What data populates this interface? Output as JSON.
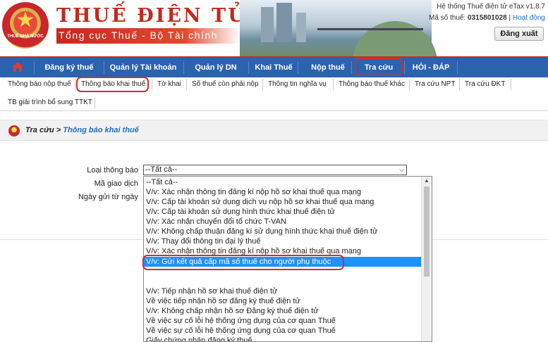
{
  "header": {
    "emblem_text": "THUẾ NHÀ NƯỚC",
    "brand_title": "THUẾ ĐIỆN TỬ",
    "brand_subtitle": "Tổng cục Thuế - Bộ Tài chính",
    "system_name": "Hệ thống Thuế điện tử eTax v1.8.7",
    "tax_code_label": "Mã số thuế:",
    "tax_code_value": "0315801028",
    "activity_link": "Hoạt động",
    "separator": "|",
    "logout_label": "Đăng xuất"
  },
  "main_nav": [
    {
      "label": "Đăng ký thuế"
    },
    {
      "label": "Quản lý Tài khoản"
    },
    {
      "label": "Quản lý DN"
    },
    {
      "label": "Khai Thuế"
    },
    {
      "label": "Nộp thuế"
    },
    {
      "label": "Tra cứu"
    },
    {
      "label": "HỎI - ĐÁP"
    }
  ],
  "sub_nav": [
    {
      "label": "Thông báo nộp thuế"
    },
    {
      "label": "Thông báo khai thuế"
    },
    {
      "label": "Tờ khai"
    },
    {
      "label": "Số thuế còn phải nộp"
    },
    {
      "label": "Thông tin nghĩa vụ"
    },
    {
      "label": "Thông báo thuế khác"
    },
    {
      "label": "Tra cứu NPT"
    },
    {
      "label": "Tra cứu ĐKT"
    },
    {
      "label": "TB giải trình bổ sung TTKT"
    }
  ],
  "breadcrumb": {
    "parent": "Tra cứu >",
    "current": "Thông báo khai thuế"
  },
  "form": {
    "notice_type_label": "Loại thông báo",
    "transaction_code_label": "Mã giao dịch",
    "send_date_label": "Ngày gửi từ ngày",
    "notice_type_value": "--Tất cả--"
  },
  "dropdown_options": [
    "--Tất cả--",
    "V/v: Xác nhận thông tin đăng kí nộp hồ sơ khai thuế qua mạng",
    "V/v: Cấp tài khoản sử dụng dịch vụ nộp hồ sơ khai thuế qua mạng",
    "V/v: Cấp tài khoản sử dụng hình thức khai thuế điện tử",
    "V/v: Xác nhận chuyển đổi tổ chức T-VAN",
    "V/v: Không chấp thuận đăng kí sử dụng hình thức khai thuế điện tử",
    "V/v: Thay đổi thông tin đại lý thuế",
    "V/v: Xác nhận thông tin đăng kí nộp hồ sơ khai thuế qua mạng",
    "V/v: Gửi kết quả cấp mã số thuế cho người phụ thuộc",
    "",
    "",
    "V/v: Tiếp nhận hồ sơ khai thuế điện tử",
    "Về việc tiếp nhận hồ sơ đăng ký thuế điện tử",
    "V/v: Không chấp nhận hồ sơ Đăng ký thuế điện tử",
    "Về việc sự cố lỗi hệ thống ứng dụng của cơ quan Thuế",
    "Về việc sự cố lỗi hệ thống ứng dụng của cơ quan Thuế",
    "Giấy chứng nhận đăng ký thuế"
  ],
  "selected_option_index": 8,
  "colors": {
    "nav_blue": "#2a63ae",
    "brand_red": "#c12a1c",
    "highlight_red": "#d62c2c",
    "selected_blue": "#1e90ff"
  }
}
